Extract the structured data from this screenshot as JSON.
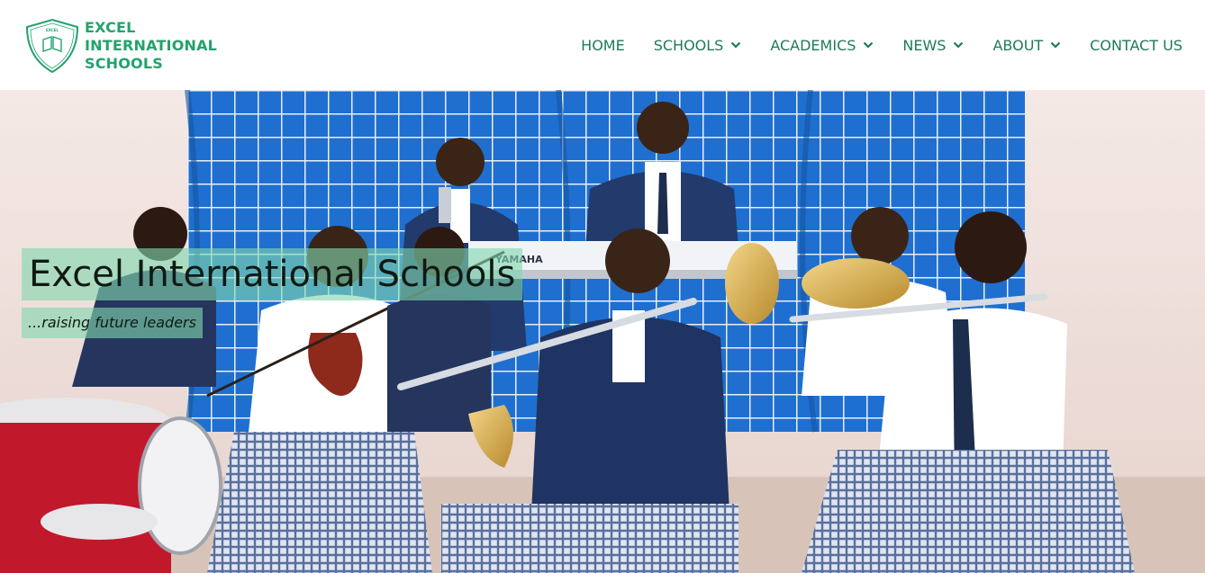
{
  "brand": {
    "logo_line1": "EXCEL",
    "logo_line2": "INTERNATIONAL",
    "logo_line3": "SCHOOLS",
    "badge_text": "EXCEL INTERNATIONAL SCHOOLS",
    "accent_color": "#23a26d",
    "nav_color": "#1f7a5a"
  },
  "nav": {
    "items": [
      {
        "label": "HOME",
        "has_dropdown": false
      },
      {
        "label": "SCHOOLS",
        "has_dropdown": true
      },
      {
        "label": "ACADEMICS",
        "has_dropdown": true
      },
      {
        "label": "NEWS",
        "has_dropdown": true
      },
      {
        "label": "ABOUT",
        "has_dropdown": true
      },
      {
        "label": "CONTACT US",
        "has_dropdown": false
      }
    ],
    "dropdown_icon": "chevron-down-icon"
  },
  "hero": {
    "title": "Excel International Schools",
    "subtitle": "...raising future leaders",
    "overlay_color": "#81d6ae",
    "keyboard_brand": "YAMAHA"
  }
}
